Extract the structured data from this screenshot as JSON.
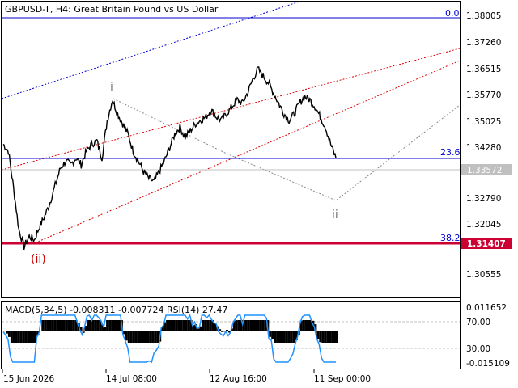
{
  "window": {
    "title": "GBPUSD-T, H4:  Great Britain Pound vs US Dollar"
  },
  "price_axis": {
    "ticks": [
      "1.38005",
      "1.37260",
      "1.36515",
      "1.35770",
      "1.35025",
      "1.34280",
      "1.33572",
      "1.32790",
      "1.32045",
      "1.31407",
      "1.30555"
    ]
  },
  "current_price": {
    "label": "1.33572",
    "value": 1.33572
  },
  "fib_levels": [
    {
      "label": "0.0",
      "value": 1.38,
      "color": "#0000cd"
    },
    {
      "label": "23.6",
      "value": 1.34,
      "color": "#0000cd"
    },
    {
      "label": "38.2",
      "value": 1.314,
      "color": "#cc0033"
    }
  ],
  "key_level": {
    "label": "1.31407",
    "color": "#cc0033"
  },
  "wave_labels": {
    "i": "i",
    "ii_gray": "ii",
    "ii_red": "(ii)"
  },
  "indicator": {
    "title": "MACD(5,34,5) -0.008311 -0.007724 RSI(14) 27.47",
    "ticks": [
      "0.011652",
      "70.00",
      "30.00",
      "-0.015109"
    ]
  },
  "time_axis": {
    "ticks": [
      "15 Jun 2026",
      "14 Jul 08:00",
      "12 Aug 16:00",
      "11 Sep 00:00"
    ]
  },
  "colors": {
    "fib_blue": "#0000cd",
    "channel_red": "#dd0000",
    "channel_blue": "#0000cc",
    "rsi_line": "#1e90ff",
    "wave_ii_red": "#cc0000"
  },
  "chart_data": {
    "type": "line",
    "series": [
      {
        "values": [
          1.343,
          1.341,
          1.33,
          1.318,
          1.313,
          1.316,
          1.315,
          1.319,
          1.322,
          1.326,
          1.331,
          1.336,
          1.338,
          1.337,
          1.339,
          1.337,
          1.341,
          1.343,
          1.344,
          1.339,
          1.35,
          1.356,
          1.352,
          1.349,
          1.346,
          1.341,
          1.338,
          1.335,
          1.333,
          1.332,
          1.335,
          1.338,
          1.342,
          1.346,
          1.348,
          1.345,
          1.347,
          1.349,
          1.35,
          1.351,
          1.353,
          1.351,
          1.35,
          1.352,
          1.354,
          1.356,
          1.355,
          1.358,
          1.362,
          1.365,
          1.363,
          1.361,
          1.358,
          1.355,
          1.352,
          1.35,
          1.352,
          1.355,
          1.357,
          1.356,
          1.354,
          1.351,
          1.348,
          1.343,
          1.339
        ]
      }
    ]
  }
}
